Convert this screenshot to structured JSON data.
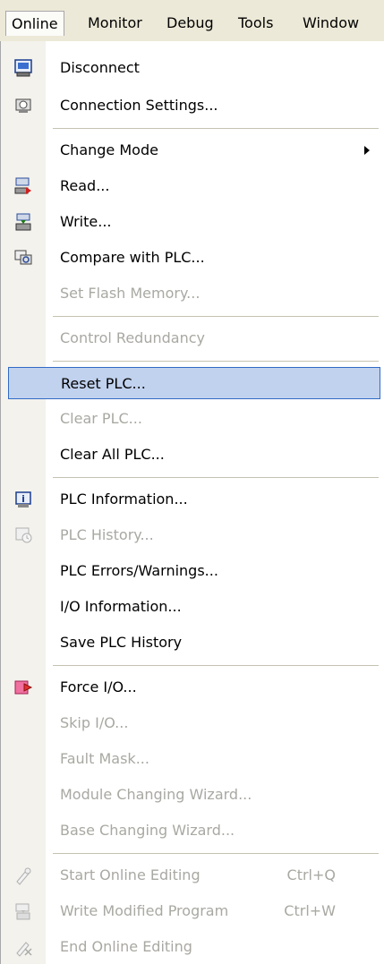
{
  "menubar": {
    "items": [
      "Online",
      "Monitor",
      "Debug",
      "Tools",
      "Window"
    ],
    "active": "Online"
  },
  "menu": {
    "items": [
      {
        "label": "Disconnect",
        "icon": "disconnect-icon"
      },
      {
        "label": "Connection Settings...",
        "icon": "connection-settings-icon"
      },
      {
        "label": "Change Mode",
        "submenu": true
      },
      {
        "label": "Read...",
        "icon": "read-from-plc-icon"
      },
      {
        "label": "Write...",
        "icon": "write-to-plc-icon"
      },
      {
        "label": "Compare with PLC...",
        "icon": "compare-icon"
      },
      {
        "label": "Set Flash Memory...",
        "disabled": true
      },
      {
        "label": "Control Redundancy",
        "disabled": true
      },
      {
        "label": "Reset PLC...",
        "highlighted": true
      },
      {
        "label": "Clear PLC...",
        "disabled": true
      },
      {
        "label": "Clear All PLC..."
      },
      {
        "label": "PLC Information...",
        "icon": "plc-information-icon"
      },
      {
        "label": "PLC History...",
        "disabled": true,
        "icon": "plc-history-icon"
      },
      {
        "label": "PLC Errors/Warnings..."
      },
      {
        "label": "I/O Information..."
      },
      {
        "label": "Save PLC History"
      },
      {
        "label": "Force I/O...",
        "icon": "force-io-icon"
      },
      {
        "label": "Skip I/O...",
        "disabled": true
      },
      {
        "label": "Fault Mask...",
        "disabled": true
      },
      {
        "label": "Module Changing Wizard...",
        "disabled": true
      },
      {
        "label": "Base Changing Wizard...",
        "disabled": true
      },
      {
        "label": "Start Online Editing",
        "shortcut": "Ctrl+Q",
        "disabled": true,
        "icon": "start-online-editing-icon"
      },
      {
        "label": "Write Modified Program",
        "shortcut": "Ctrl+W",
        "disabled": true,
        "icon": "write-modified-program-icon"
      },
      {
        "label": "End Online Editing",
        "disabled": true,
        "icon": "end-online-editing-icon"
      }
    ]
  },
  "colors": {
    "highlight_fill": "#c1d2ee",
    "highlight_border": "#316ac5",
    "disabled_text": "#a9a8a2",
    "menubar_bg": "#ece9d8"
  }
}
